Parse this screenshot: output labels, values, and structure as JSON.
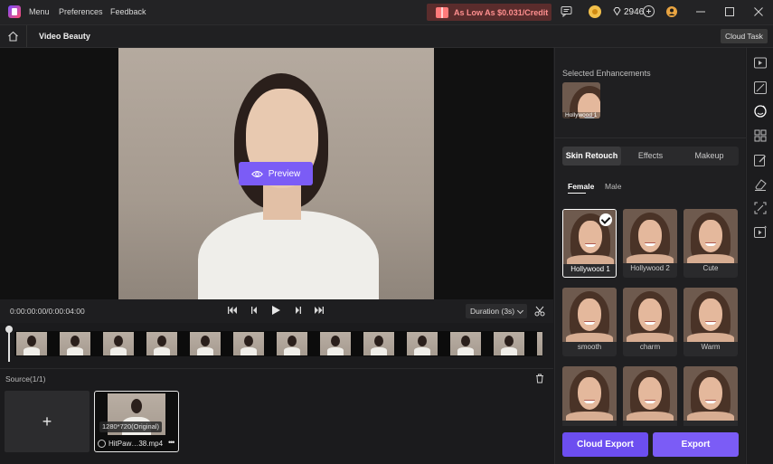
{
  "titlebar": {
    "menu_items": [
      "Menu",
      "Preferences",
      "Feedback"
    ],
    "promo_text": "As Low As $0.031/Credit",
    "credits": "2946"
  },
  "header": {
    "title": "Video Beauty",
    "cloud_task": "Cloud Task"
  },
  "preview": {
    "button_label": "Preview"
  },
  "controls": {
    "timecode": "0:00:00:00/0:00:04:00",
    "duration": "Duration (3s)"
  },
  "source": {
    "label": "Source(1/1)",
    "resolution": "1280*720(Original)",
    "filename": "HitPaw…38.mp4",
    "more": "•••",
    "add_symbol": "+"
  },
  "panel": {
    "selected_label": "Selected Enhancements",
    "selected_item": "Hollywood 1",
    "tabs": [
      "Skin Retouch",
      "Effects",
      "Makeup"
    ],
    "genders": [
      "Female",
      "Male"
    ],
    "presets": [
      "Hollywood 1",
      "Hollywood 2",
      "Cute",
      "smooth",
      "charm",
      "Warm",
      "",
      "",
      ""
    ],
    "cloud_export": "Cloud Export",
    "export": "Export"
  },
  "colors": {
    "accent": "#7b5cf6",
    "promo_text": "#ff8f8f",
    "coin": "#f3c04b"
  }
}
